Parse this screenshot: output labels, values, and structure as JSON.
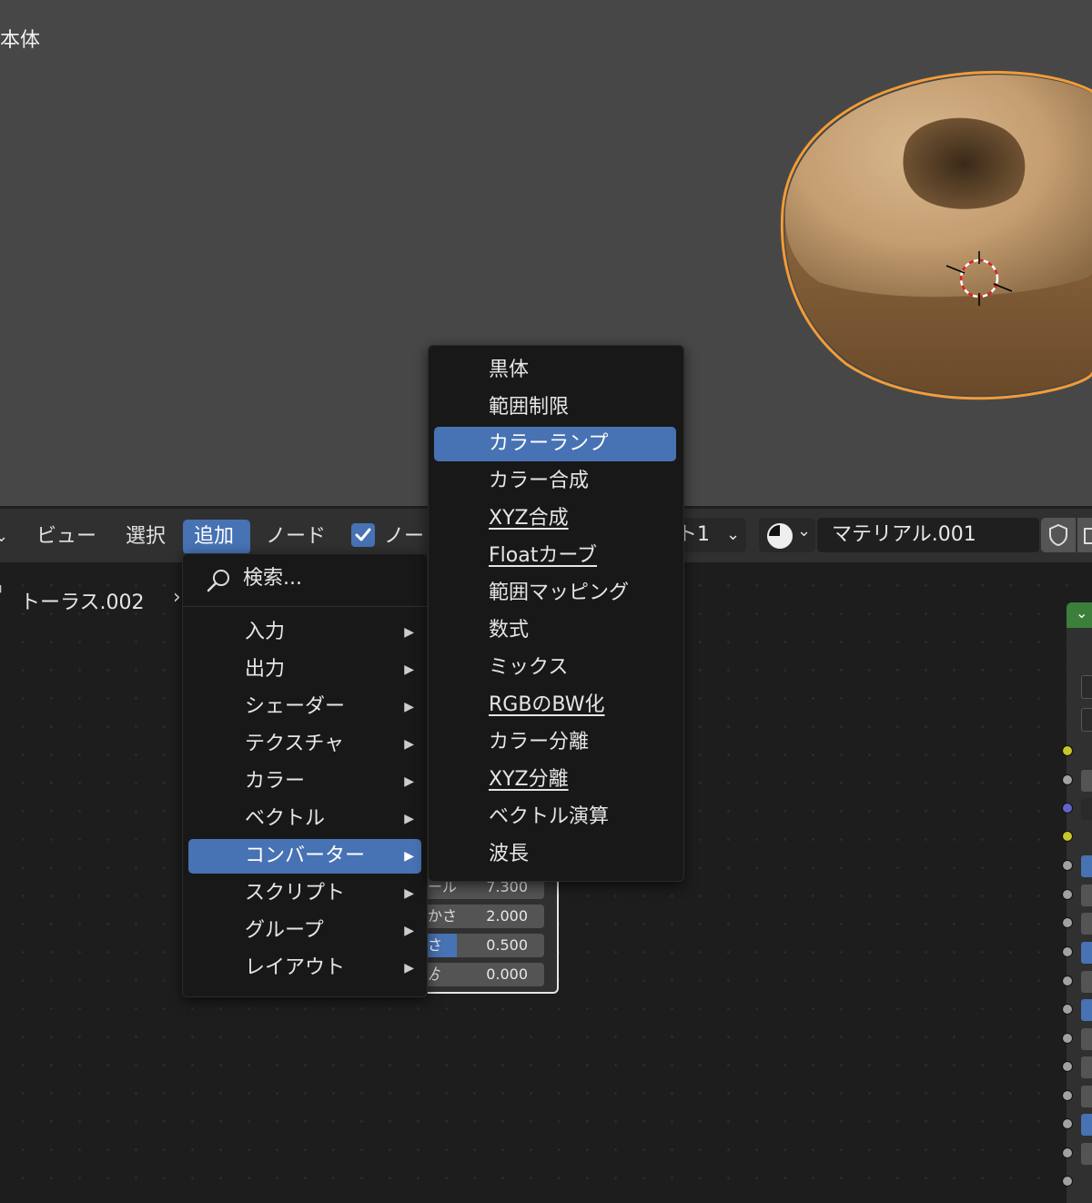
{
  "viewport": {
    "label": "本体"
  },
  "header": {
    "menus": [
      "ビュー",
      "選択",
      "追加",
      "ノード"
    ],
    "use_nodes_label": "ノー",
    "slot_label": "ト1",
    "material_name": "マテリアル.001"
  },
  "breadcrumb": {
    "object": "トーラス.002"
  },
  "add_menu": {
    "search": "検索...",
    "items": [
      "入力",
      "出力",
      "シェーダー",
      "テクスチャ",
      "カラー",
      "ベクトル",
      "コンバーター",
      "スクリプト",
      "グループ",
      "レイアウト"
    ],
    "active_index": 6
  },
  "converter_menu": {
    "items": [
      "黒体",
      "範囲制限",
      "カラーランプ",
      "カラー合成",
      "XYZ合成",
      "Floatカーブ",
      "範囲マッピング",
      "数式",
      "ミックス",
      "RGBのBW化",
      "カラー分離",
      "XYZ分離",
      "ベクトル演算",
      "波長"
    ],
    "highlighted_index": 2
  },
  "node": {
    "fields": [
      {
        "label": "ール",
        "value": "7.300",
        "fill": 0
      },
      {
        "label": "かさ",
        "value": "2.000",
        "fill": 0
      },
      {
        "label": "さ",
        "value": "0.500",
        "fill": 0.28
      },
      {
        "label": "ゟ",
        "value": "0.000",
        "fill": 0
      }
    ]
  },
  "colors": {
    "accent": "#4772b3",
    "selection_outline": "#f29c38",
    "node_header": "#3b7f3b"
  }
}
